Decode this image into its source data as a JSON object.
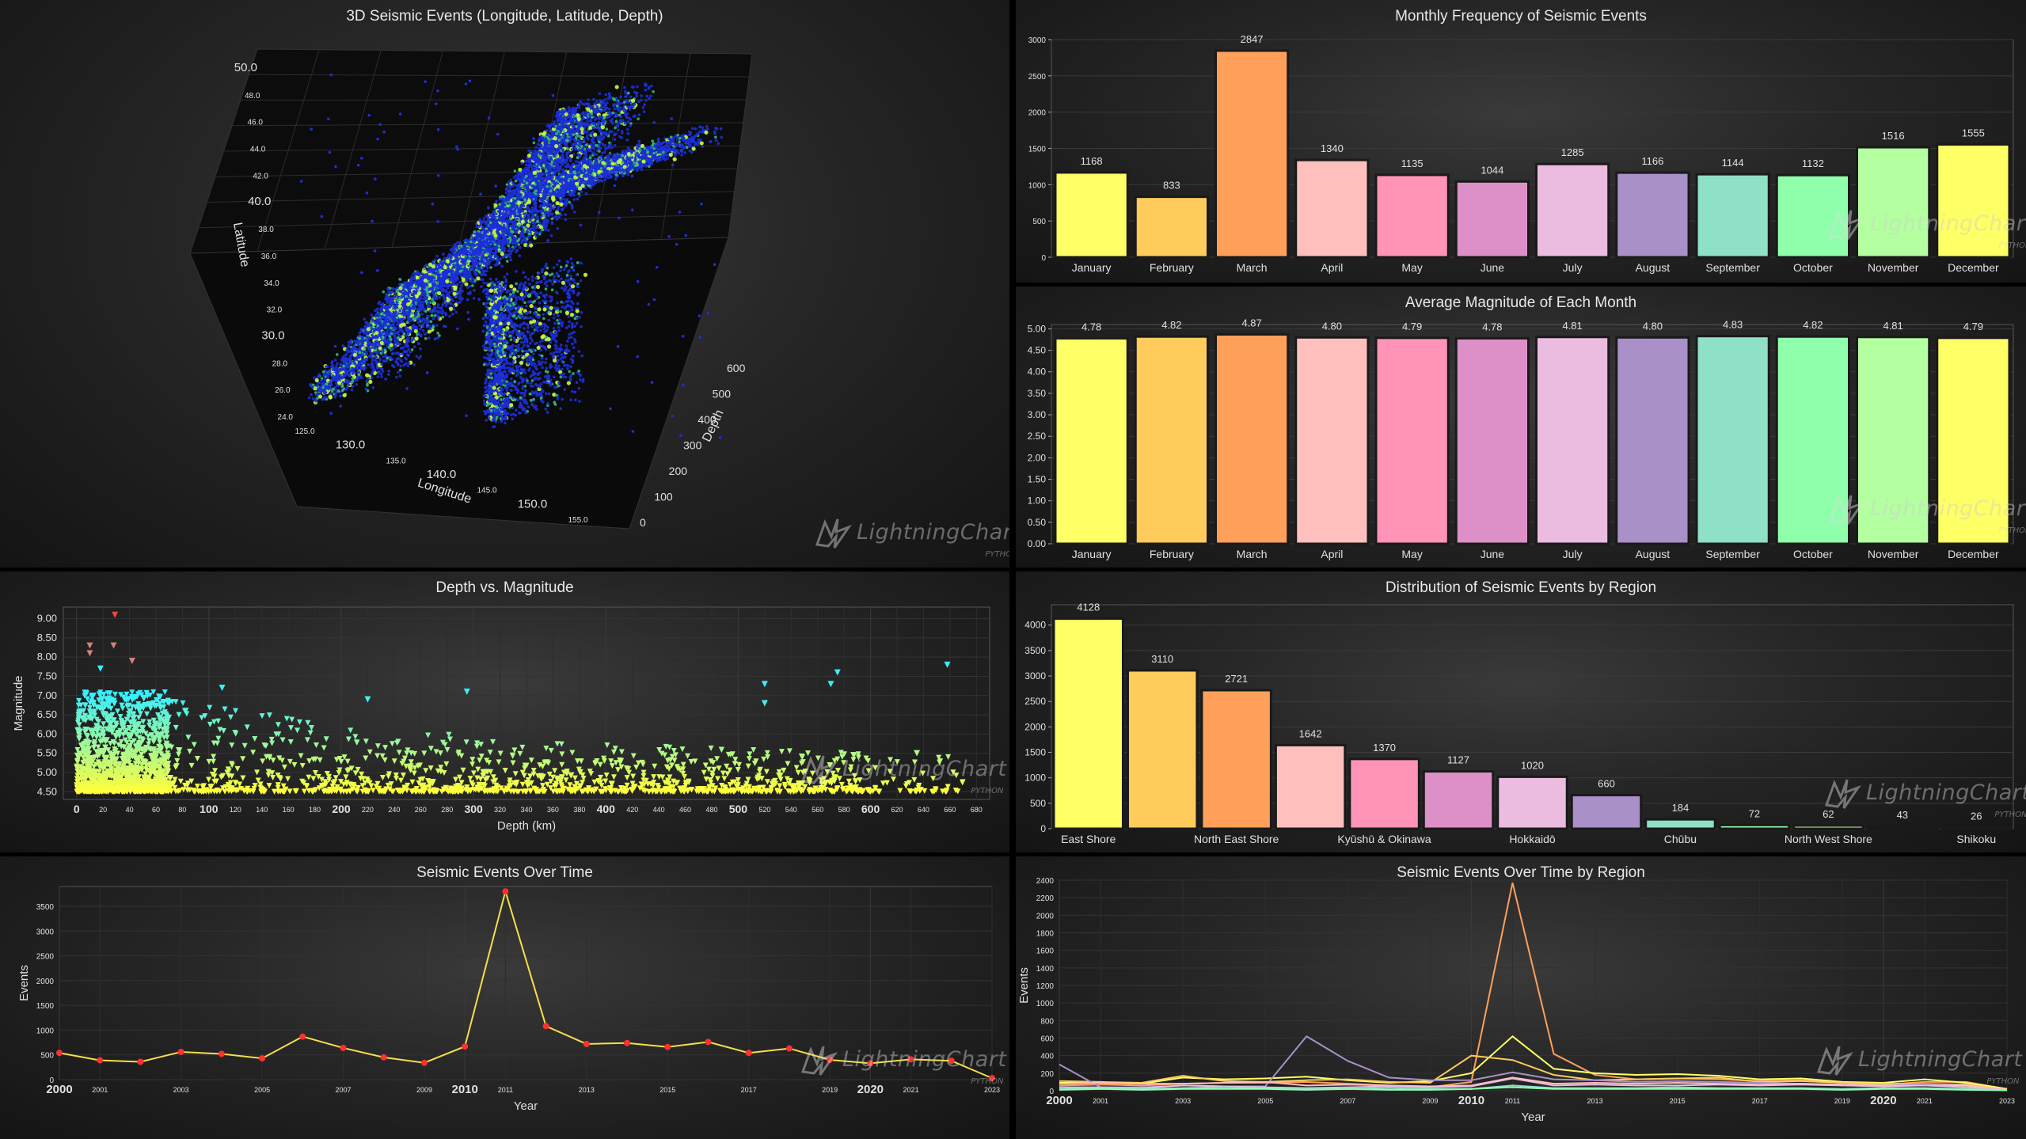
{
  "watermark": {
    "brand": "LightningChart",
    "sub": "PYTHON"
  },
  "panels": {
    "p3d": {
      "title": "3D Seismic Events (Longitude, Latitude, Depth)"
    },
    "monthly_freq": {
      "title": "Monthly Frequency of Seismic Events"
    },
    "avg_mag": {
      "title": "Average Magnitude of Each Month"
    },
    "depth_mag": {
      "title": "Depth vs. Magnitude"
    },
    "region_dist": {
      "title": "Distribution of Seismic Events by Region"
    },
    "time": {
      "title": "Seismic Events Over Time"
    },
    "time_region": {
      "title": "Seismic Events Over Time by Region"
    }
  },
  "colors": {
    "bars": [
      "#ffff66",
      "#ffcc5c",
      "#ffa05a",
      "#ffc0bd",
      "#ff94b6",
      "#dd90c8",
      "#ebbbe0",
      "#a990c8",
      "#8ee0c6",
      "#90ffac",
      "#b4ffa0",
      "#ffff66"
    ],
    "line": "#f4e04a",
    "marker": "#ff3030"
  },
  "chart_data": [
    {
      "id": "p3d",
      "type": "scatter",
      "title": "3D Seismic Events (Longitude, Latitude, Depth)",
      "xlabel": "Longitude",
      "ylabel": "Latitude",
      "zlabel": "Depth",
      "x_ticks": [
        "125.0",
        "130.0",
        "135.0",
        "140.0",
        "145.0",
        "150.0",
        "155.0"
      ],
      "y_ticks": [
        "24.0",
        "26.0",
        "28.0",
        "30.0",
        "32.0",
        "34.0",
        "36.0",
        "38.0",
        "40.0",
        "42.0",
        "44.0",
        "46.0",
        "48.0",
        "50.0"
      ],
      "z_ticks": [
        "0",
        "100",
        "200",
        "300",
        "400",
        "500",
        "600"
      ],
      "xlim": [
        123,
        157
      ],
      "ylim": [
        23,
        51
      ],
      "zlim": [
        0,
        680
      ],
      "trend_segments": [
        {
          "x": [
            124.5,
            129.5,
            132.5
          ],
          "y": [
            24.2,
            29.5,
            33.0
          ]
        },
        {
          "x": [
            132.0,
            136.0,
            140.0,
            143.0,
            146.0,
            149.0
          ],
          "y": [
            33.0,
            35.5,
            38.5,
            42.0,
            46.0,
            50.0
          ]
        },
        {
          "x": [
            140.0,
            140.5,
            141.0
          ],
          "y": [
            24.0,
            30.0,
            35.0
          ]
        },
        {
          "x": [
            145.5,
            149.5,
            155.0
          ],
          "y": [
            43.0,
            45.0,
            47.0
          ]
        }
      ]
    },
    {
      "id": "monthly_freq",
      "type": "bar",
      "title": "Monthly Frequency of Seismic Events",
      "categories": [
        "January",
        "February",
        "March",
        "April",
        "May",
        "June",
        "July",
        "August",
        "September",
        "October",
        "November",
        "December"
      ],
      "values": [
        1168,
        833,
        2847,
        1340,
        1135,
        1044,
        1285,
        1166,
        1144,
        1132,
        1516,
        1555
      ],
      "value_labels": [
        "1168",
        "833",
        "2847",
        "1340",
        "1135",
        "1044",
        "1285",
        "1166",
        "1144",
        "1132",
        "1516",
        "1555"
      ],
      "ylim": [
        0,
        3000
      ],
      "y_ticks": [
        "0",
        "500",
        "1000",
        "1500",
        "2000",
        "2500",
        "3000"
      ]
    },
    {
      "id": "avg_mag",
      "type": "bar",
      "title": "Average Magnitude of Each Month",
      "categories": [
        "January",
        "February",
        "March",
        "April",
        "May",
        "June",
        "July",
        "August",
        "September",
        "October",
        "November",
        "December"
      ],
      "values": [
        4.78,
        4.82,
        4.87,
        4.8,
        4.79,
        4.78,
        4.81,
        4.8,
        4.83,
        4.82,
        4.81,
        4.79
      ],
      "value_labels": [
        "4.78",
        "4.82",
        "4.87",
        "4.80",
        "4.79",
        "4.78",
        "4.81",
        "4.80",
        "4.83",
        "4.82",
        "4.81",
        "4.79"
      ],
      "ylim": [
        0,
        5.1
      ],
      "y_ticks": [
        "0.00",
        "0.50",
        "1.00",
        "1.50",
        "2.00",
        "2.50",
        "3.00",
        "3.50",
        "4.00",
        "4.50",
        "5.00"
      ]
    },
    {
      "id": "depth_mag",
      "type": "scatter",
      "title": "Depth vs. Magnitude",
      "xlabel": "Depth (km)",
      "ylabel": "Magnitude",
      "xlim": [
        -10,
        690
      ],
      "ylim": [
        4.3,
        9.3
      ],
      "x_ticks_major": [
        "0",
        "100",
        "200",
        "300",
        "400",
        "500",
        "600"
      ],
      "x_ticks_minor": [
        "20",
        "40",
        "60",
        "80",
        "120",
        "140",
        "160",
        "180",
        "220",
        "240",
        "260",
        "280",
        "320",
        "340",
        "360",
        "380",
        "420",
        "440",
        "460",
        "480",
        "520",
        "540",
        "560",
        "580",
        "620",
        "640",
        "660",
        "680"
      ],
      "y_ticks": [
        "4.50",
        "5.00",
        "5.50",
        "6.00",
        "6.50",
        "7.00",
        "7.50",
        "8.00",
        "8.50",
        "9.00"
      ],
      "outliers": [
        {
          "x": 29,
          "y": 9.1
        },
        {
          "x": 10,
          "y": 8.3
        },
        {
          "x": 28,
          "y": 8.3
        },
        {
          "x": 10,
          "y": 8.1
        },
        {
          "x": 42,
          "y": 7.9
        },
        {
          "x": 18,
          "y": 7.7
        },
        {
          "x": 658,
          "y": 7.8
        },
        {
          "x": 575,
          "y": 7.6
        },
        {
          "x": 295,
          "y": 7.1
        },
        {
          "x": 110,
          "y": 7.2
        },
        {
          "x": 220,
          "y": 6.9
        },
        {
          "x": 570,
          "y": 7.3
        },
        {
          "x": 520,
          "y": 7.3
        },
        {
          "x": 520,
          "y": 6.8
        },
        {
          "x": 635,
          "y": 5.5
        }
      ]
    },
    {
      "id": "region_dist",
      "type": "bar",
      "title": "Distribution of Seismic Events by Region",
      "categories": [
        "East Shore",
        "",
        "North East Shore",
        "",
        "Kyūshū & Okinawa",
        "",
        "Hokkaidō",
        "",
        "Chūbu",
        "",
        "North West Shore",
        "",
        "Shikoku"
      ],
      "values": [
        4128,
        3110,
        2721,
        1642,
        1370,
        1127,
        1020,
        660,
        184,
        72,
        62,
        43,
        26
      ],
      "value_labels": [
        "4128",
        "3110",
        "2721",
        "1642",
        "1370",
        "1127",
        "1020",
        "660",
        "184",
        "72",
        "62",
        "43",
        "26"
      ],
      "ylim": [
        0,
        4400
      ],
      "y_ticks": [
        "0",
        "500",
        "1000",
        "1500",
        "2000",
        "2500",
        "3000",
        "3500",
        "4000"
      ]
    },
    {
      "id": "time",
      "type": "line",
      "title": "Seismic Events Over Time",
      "xlabel": "Year",
      "ylabel": "Events",
      "x": [
        2000,
        2001,
        2002,
        2003,
        2004,
        2005,
        2006,
        2007,
        2008,
        2009,
        2010,
        2011,
        2012,
        2013,
        2014,
        2015,
        2016,
        2017,
        2018,
        2019,
        2020,
        2021,
        2022,
        2023
      ],
      "values": [
        540,
        390,
        360,
        560,
        520,
        430,
        870,
        640,
        450,
        340,
        670,
        3800,
        1080,
        720,
        740,
        660,
        760,
        540,
        630,
        400,
        330,
        410,
        380,
        30
      ],
      "xlim": [
        2000,
        2023
      ],
      "ylim": [
        0,
        3900
      ],
      "x_ticks_major": [
        "2000",
        "2010",
        "2020"
      ],
      "x_ticks_minor": [
        "2001",
        "2003",
        "2005",
        "2007",
        "2009",
        "2011",
        "2013",
        "2015",
        "2017",
        "2019",
        "2021",
        "2023"
      ],
      "y_ticks": [
        "0",
        "500",
        "1000",
        "1500",
        "2000",
        "2500",
        "3000",
        "3500"
      ]
    },
    {
      "id": "time_region",
      "type": "line",
      "title": "Seismic Events Over Time by Region",
      "xlabel": "Year",
      "ylabel": "Events",
      "x": [
        2000,
        2001,
        2002,
        2003,
        2004,
        2005,
        2006,
        2007,
        2008,
        2009,
        2010,
        2011,
        2012,
        2013,
        2014,
        2015,
        2016,
        2017,
        2018,
        2019,
        2020,
        2021,
        2022,
        2023
      ],
      "xlim": [
        2000,
        2023
      ],
      "ylim": [
        0,
        2400
      ],
      "x_ticks_major": [
        "2000",
        "2010",
        "2020"
      ],
      "x_ticks_minor": [
        "2001",
        "2003",
        "2005",
        "2007",
        "2009",
        "2011",
        "2013",
        "2015",
        "2017",
        "2019",
        "2021",
        "2023"
      ],
      "y_ticks": [
        "0",
        "200",
        "400",
        "600",
        "800",
        "1000",
        "1200",
        "1400",
        "1600",
        "1800",
        "2000",
        "2200",
        "2400"
      ],
      "series": [
        {
          "color": "#ffa05a",
          "values": [
            60,
            70,
            60,
            80,
            90,
            90,
            100,
            80,
            60,
            40,
            100,
            2370,
            420,
            180,
            130,
            140,
            130,
            110,
            120,
            90,
            70,
            100,
            100,
            20
          ]
        },
        {
          "color": "#ffff66",
          "values": [
            90,
            90,
            80,
            150,
            130,
            140,
            160,
            120,
            90,
            110,
            200,
            620,
            250,
            200,
            180,
            190,
            170,
            130,
            140,
            100,
            90,
            130,
            90,
            20
          ]
        },
        {
          "color": "#ffcc5c",
          "values": [
            110,
            100,
            90,
            170,
            110,
            100,
            120,
            130,
            100,
            90,
            400,
            350,
            180,
            120,
            130,
            140,
            150,
            100,
            110,
            90,
            80,
            80,
            70,
            10
          ]
        },
        {
          "color": "#a990c8",
          "values": [
            300,
            40,
            40,
            60,
            50,
            50,
            620,
            340,
            150,
            120,
            120,
            210,
            130,
            120,
            100,
            110,
            100,
            90,
            80,
            70,
            60,
            80,
            60,
            10
          ]
        },
        {
          "color": "#ffc0bd",
          "values": [
            80,
            90,
            80,
            80,
            90,
            100,
            60,
            70,
            60,
            50,
            60,
            150,
            80,
            90,
            80,
            90,
            80,
            70,
            80,
            70,
            60,
            60,
            60,
            10
          ]
        },
        {
          "color": "#ebbbe0",
          "values": [
            40,
            40,
            30,
            60,
            50,
            40,
            30,
            40,
            50,
            40,
            50,
            140,
            60,
            70,
            60,
            60,
            70,
            60,
            70,
            60,
            50,
            60,
            40,
            10
          ]
        },
        {
          "color": "#8ee0c6",
          "values": [
            20,
            30,
            20,
            30,
            40,
            30,
            20,
            20,
            30,
            20,
            20,
            60,
            30,
            30,
            30,
            40,
            30,
            30,
            30,
            20,
            30,
            30,
            20,
            5
          ]
        },
        {
          "color": "#90ffac",
          "values": [
            10,
            20,
            10,
            20,
            20,
            20,
            10,
            20,
            10,
            10,
            20,
            40,
            20,
            20,
            20,
            20,
            20,
            20,
            20,
            10,
            20,
            20,
            10,
            5
          ]
        }
      ]
    }
  ]
}
